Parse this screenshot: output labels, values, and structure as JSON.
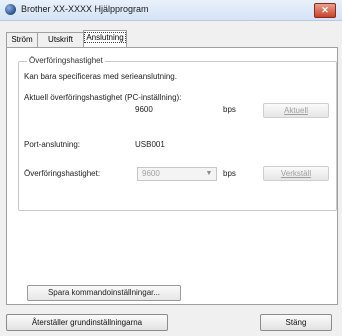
{
  "window": {
    "title": "Brother XX-XXXX Hjälpprogram",
    "close_glyph": "✕"
  },
  "tabs": [
    {
      "label": "Ström"
    },
    {
      "label": "Utskrift"
    },
    {
      "label": "Anslutning",
      "selected": true
    }
  ],
  "transfer_speed_group": {
    "title": "Överföringshastighet",
    "note": "Kan bara specificeras med serieanslutning.",
    "current_speed_label": "Aktuell överföringshastighet (PC-inställning):",
    "current_speed_value": "9600",
    "current_speed_unit": "bps",
    "current_button": "Aktuell",
    "port_label": "Port-anslutning:",
    "port_value": "USB001",
    "speed_label": "Överföringshastighet:",
    "speed_select_value": "9600",
    "speed_unit": "bps",
    "apply_button": "Verkställ"
  },
  "save_button": "Spara kommandoinställningar...",
  "reset_button": "Återställer grundinställningarna",
  "close_button": "Stäng",
  "icons": {
    "app": "printer-app-icon",
    "close": "close-icon",
    "dropdown": "chevron-down-icon"
  }
}
